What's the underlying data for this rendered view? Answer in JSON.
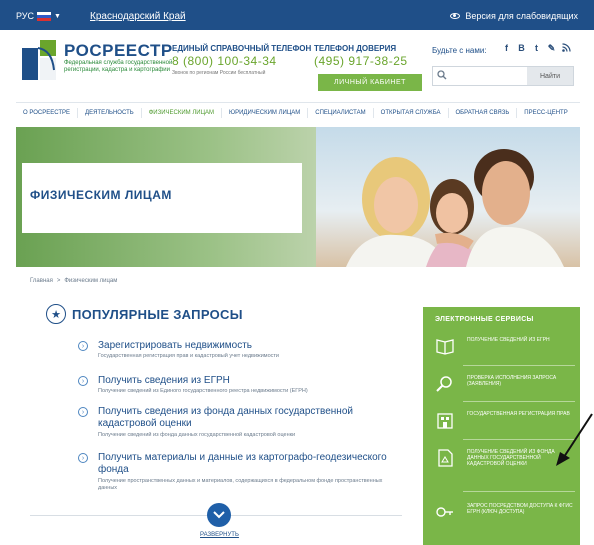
{
  "topbar": {
    "lang": "РУС",
    "region": "Краснодарский Край",
    "vision_link": "Версия для слабовидящих"
  },
  "header": {
    "logo_name": "РОСРЕЕСТР",
    "logo_subtitle": "Федеральная служба государственной регистрации, кадастра и картографии",
    "phone1_label": "ЕДИНЫЙ СПРАВОЧНЫЙ ТЕЛЕФОН",
    "phone1_number": "8 (800) 100-34-34",
    "phone1_note": "Звонок по регионам России бесплатный",
    "phone2_label": "ТЕЛЕФОН ДОВЕРИЯ",
    "phone2_number": "(495) 917-38-25",
    "cabinet_button": "ЛИЧНЫЙ КАБИНЕТ",
    "social_label": "Будьте с нами:",
    "social_icons": [
      "f",
      "В",
      "t",
      "✎",
      "rss"
    ],
    "search_placeholder": "",
    "search_button": "Найти"
  },
  "nav": {
    "items": [
      {
        "label": "О РОСРЕЕСТРЕ",
        "active": false
      },
      {
        "label": "ДЕЯТЕЛЬНОСТЬ",
        "active": false
      },
      {
        "label": "ФИЗИЧЕСКИМ ЛИЦАМ",
        "active": true
      },
      {
        "label": "ЮРИДИЧЕСКИМ ЛИЦАМ",
        "active": false
      },
      {
        "label": "СПЕЦИАЛИСТАМ",
        "active": false
      },
      {
        "label": "ОТКРЫТАЯ СЛУЖБА",
        "active": false
      },
      {
        "label": "ОБРАТНАЯ СВЯЗЬ",
        "active": false
      },
      {
        "label": "ПРЕСС-ЦЕНТР",
        "active": false
      }
    ]
  },
  "hero": {
    "title": "ФИЗИЧЕСКИМ ЛИЦАМ"
  },
  "breadcrumb": {
    "home": "Главная",
    "separator": ">",
    "current": "Физическим лицам"
  },
  "popular": {
    "title": "ПОПУЛЯРНЫЕ ЗАПРОСЫ",
    "requests": [
      {
        "title": "Зарегистрировать недвижимость",
        "description": "Государственная регистрация прав и кадастровый учет недвижимости"
      },
      {
        "title": "Получить сведения из ЕГРН",
        "description": "Получение сведений из Единого государственного реестра недвижимости (ЕГРН)"
      },
      {
        "title": "Получить сведения из фонда данных государственной кадастровой оценки",
        "description": "Получение сведений из фонда данных государственной кадастровой оценки"
      },
      {
        "title": "Получить материалы и данные из картографо-геодезического фонда",
        "description": "Получение пространственных данных и материалов, содержащихся в федеральном фонде пространственных данных"
      }
    ],
    "more_label": "РАЗВЕРНУТЬ"
  },
  "eservices": {
    "title": "ЭЛЕКТРОННЫЕ СЕРВИСЫ",
    "items": [
      {
        "label": "Получение сведений из ЕГРН",
        "icon": "book-icon"
      },
      {
        "label": "Проверка исполнения запроса (заявления)",
        "icon": "magnifier-icon"
      },
      {
        "label": "Государственная регистрация прав",
        "icon": "building-icon"
      },
      {
        "label": "Получение сведений из фонда данных государственной кадастровой оценки",
        "icon": "document-icon"
      },
      {
        "label": "Запрос посредством доступа к ФГИС ЕГРН (ключ доступа)",
        "icon": "key-icon"
      }
    ]
  },
  "colors": {
    "brand_blue": "#1f4f88",
    "accent_green": "#7ab648"
  }
}
